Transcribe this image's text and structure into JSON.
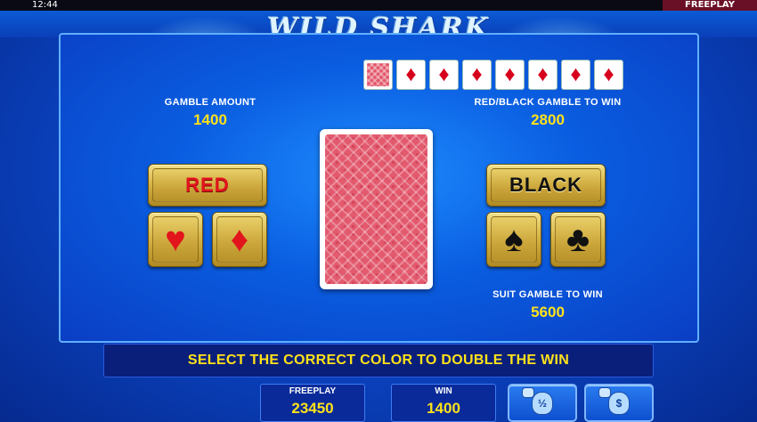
{
  "status_bar": {
    "time": "12:44",
    "mode": "FREEPLAY"
  },
  "header": {
    "title": "WILD SHARK"
  },
  "history": {
    "cards": [
      {
        "type": "back"
      },
      {
        "type": "suit",
        "suit": "diamond",
        "glyph": "♦"
      },
      {
        "type": "suit",
        "suit": "diamond",
        "glyph": "♦"
      },
      {
        "type": "suit",
        "suit": "diamond",
        "glyph": "♦"
      },
      {
        "type": "suit",
        "suit": "diamond",
        "glyph": "♦"
      },
      {
        "type": "suit",
        "suit": "diamond",
        "glyph": "♦"
      },
      {
        "type": "suit",
        "suit": "diamond",
        "glyph": "♦"
      },
      {
        "type": "suit",
        "suit": "diamond",
        "glyph": "♦"
      }
    ]
  },
  "gamble": {
    "amount_label": "GAMBLE AMOUNT",
    "amount_value": "1400",
    "color_win_label": "RED/BLACK GAMBLE TO WIN",
    "color_win_value": "2800",
    "suit_win_label": "SUIT GAMBLE TO WIN",
    "suit_win_value": "5600"
  },
  "buttons": {
    "red": "RED",
    "black": "BLACK",
    "hearts": "♥",
    "diamonds": "♦",
    "spades": "♠",
    "clubs": "♣"
  },
  "message": "SELECT THE CORRECT COLOR TO DOUBLE THE WIN",
  "bottom": {
    "credit_label": "FREEPLAY",
    "credit_value": "23450",
    "win_label": "WIN",
    "win_value": "1400",
    "half_collect_glyph": "½",
    "collect_glyph": "$"
  },
  "colors": {
    "accent_yellow": "#ffe21a",
    "card_red": "#d6001c",
    "panel_blue": "#0a5de0",
    "gold": "#d8b646"
  }
}
